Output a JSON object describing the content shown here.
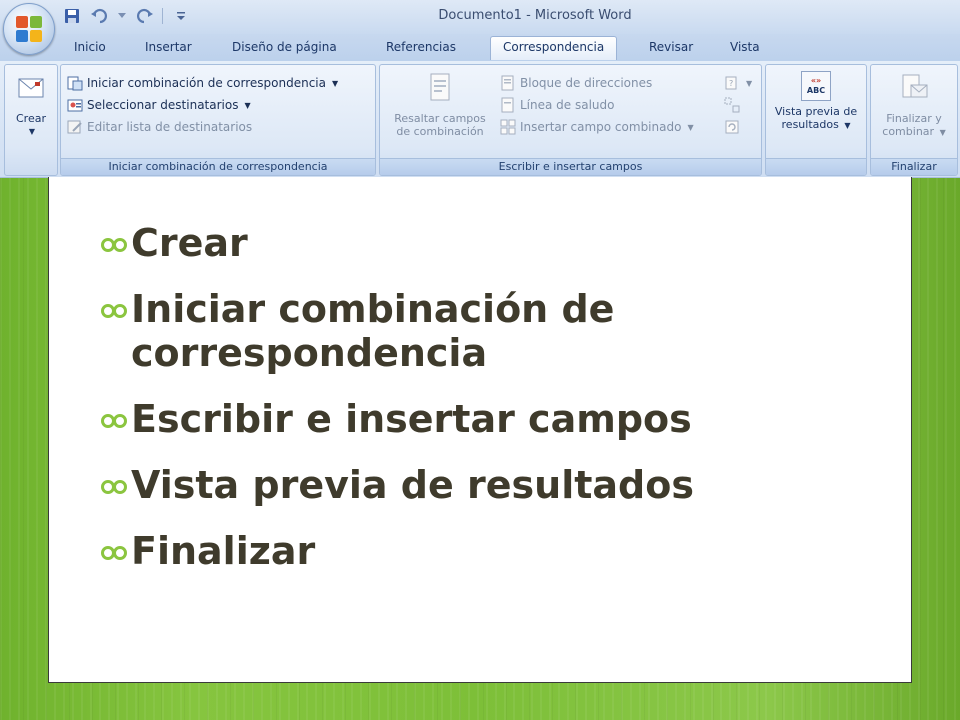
{
  "window": {
    "title": "Documento1 - Microsoft Word"
  },
  "tabs": [
    {
      "label": "Inicio"
    },
    {
      "label": "Insertar"
    },
    {
      "label": "Diseño de página"
    },
    {
      "label": "Referencias"
    },
    {
      "label": "Correspondencia"
    },
    {
      "label": "Revisar"
    },
    {
      "label": "Vista"
    }
  ],
  "ribbon": {
    "crear": {
      "label": "Crear"
    },
    "iniciar": {
      "items": [
        "Iniciar combinación de correspondencia",
        "Seleccionar destinatarios",
        "Editar lista de destinatarios"
      ],
      "group_label": "Iniciar combinación de correspondencia"
    },
    "escribir": {
      "resaltar_line1": "Resaltar campos",
      "resaltar_line2": "de combinación",
      "items": [
        "Bloque de direcciones",
        "Línea de saludo",
        "Insertar campo combinado"
      ],
      "group_label": "Escribir e insertar campos"
    },
    "vista": {
      "icon_text": "ABC",
      "line1": "Vista previa de",
      "line2": "resultados"
    },
    "finalizar": {
      "line1": "Finalizar y",
      "line2": "combinar",
      "group_label": "Finalizar"
    }
  },
  "slide": {
    "bullets": [
      "Crear",
      "Iniciar combinación de correspondencia",
      "Escribir e insertar campos",
      "Vista previa de resultados",
      "Finalizar"
    ]
  },
  "colors": {
    "accent_green": "#7dbf38",
    "bullet_mark": "#8bc53f",
    "bullet_text": "#3f3b2c"
  }
}
